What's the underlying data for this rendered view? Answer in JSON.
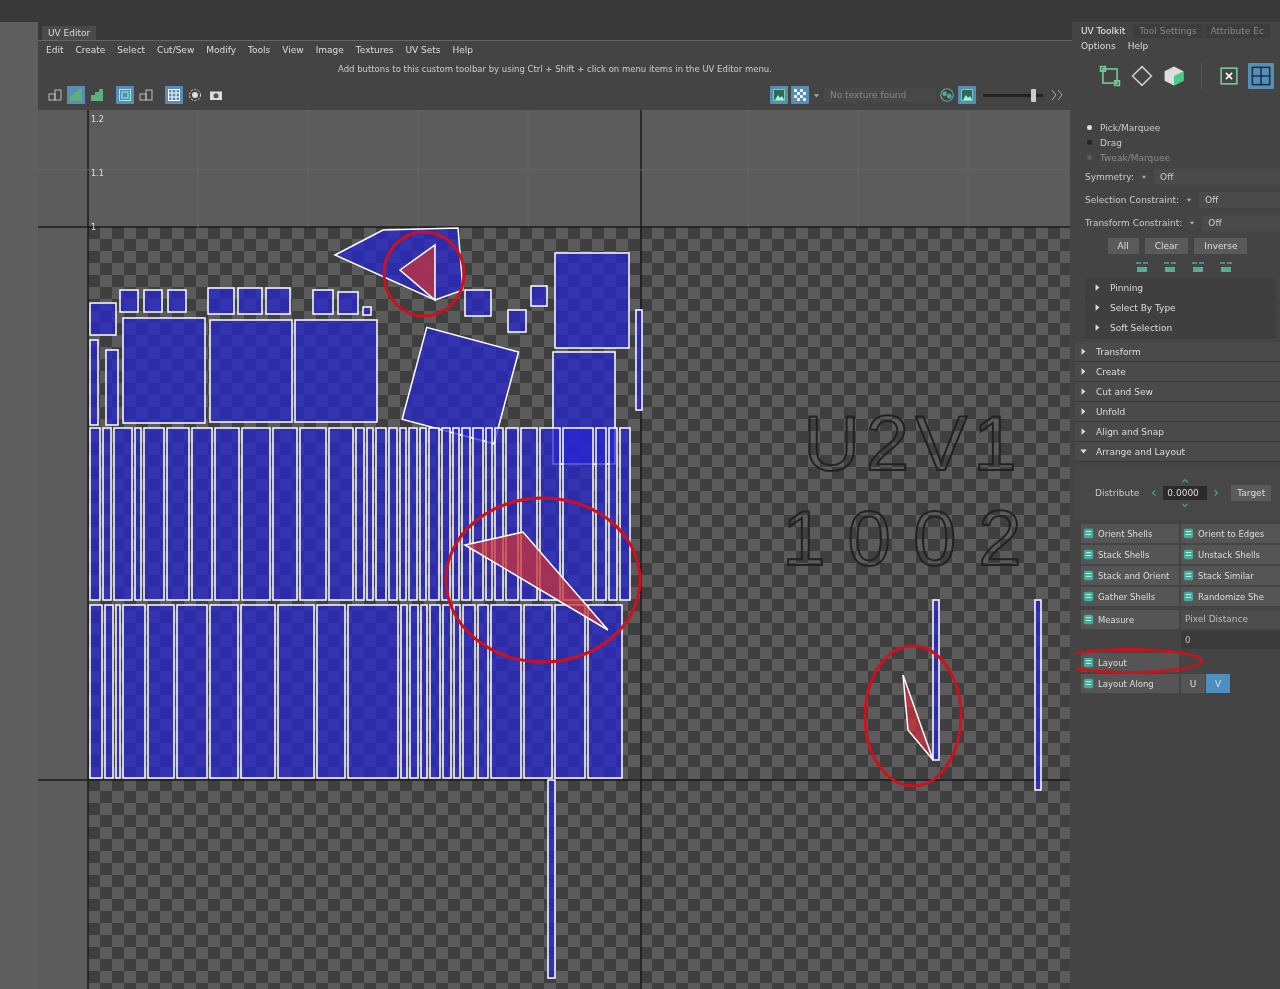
{
  "uv_editor": {
    "title": "UV Editor",
    "menu": [
      "Edit",
      "Create",
      "Select",
      "Cut/Sew",
      "Modify",
      "Tools",
      "View",
      "Image",
      "Textures",
      "UV Sets",
      "Help"
    ],
    "hint": "Add buttons to this custom toolbar by using Ctrl + Shift + click on menu items in the UV Editor menu.",
    "toolbar_left": [
      {
        "kind": "grid",
        "selected": false
      },
      {
        "kind": "shaded",
        "selected": true
      },
      {
        "kind": "shaded",
        "selected": false
      },
      {
        "kind": "frame",
        "selected": true
      },
      {
        "kind": "grid",
        "selected": false
      },
      {
        "kind": "dense-grid",
        "selected": true
      },
      {
        "kind": "dashed-circle",
        "selected": false
      },
      {
        "kind": "camera",
        "selected": false
      }
    ],
    "toolbar_right": [
      {
        "kind": "image",
        "selected": true
      },
      {
        "kind": "checker",
        "selected": true
      }
    ],
    "texture": "No texture found",
    "exposure": {
      "level": 0.85
    }
  },
  "viewport": {
    "axis_labels": [
      "1.2",
      "1.1",
      "1"
    ],
    "tiles": [
      {
        "label": "U2V1",
        "udim": "1002"
      }
    ]
  },
  "toolkit": {
    "tabs": [
      {
        "label": "UV Toolkit",
        "selected": true
      },
      {
        "label": "Tool Settings",
        "selected": false
      },
      {
        "label": "Attribute Ec",
        "selected": false
      }
    ],
    "menu": [
      "Options",
      "Help"
    ],
    "modes": [
      {
        "kind": "vertex",
        "selected": false
      },
      {
        "kind": "edge",
        "selected": false
      },
      {
        "kind": "face",
        "selected": false
      },
      {
        "kind": "uv",
        "selected": false
      },
      {
        "kind": "shell",
        "selected": true
      }
    ],
    "tool_modes": [
      {
        "label": "Pick/Marquee",
        "selected": true,
        "disabled": false
      },
      {
        "label": "Drag",
        "selected": false,
        "disabled": false
      },
      {
        "label": "Tweak/Marquee",
        "selected": false,
        "disabled": true
      }
    ],
    "constraints": [
      {
        "label": "Symmetry:",
        "value": "Off"
      },
      {
        "label": "Selection Constraint:",
        "value": "Off"
      },
      {
        "label": "Transform Constraint:",
        "value": "Off"
      }
    ],
    "buttons": [
      "All",
      "Clear",
      "Inverse"
    ],
    "sections": [
      {
        "label": "Pinning",
        "kind": "sub",
        "expanded": false
      },
      {
        "label": "Select By Type",
        "kind": "sub",
        "expanded": false
      },
      {
        "label": "Soft Selection",
        "kind": "sub",
        "expanded": false
      },
      {
        "label": "Transform",
        "kind": "main",
        "expanded": false
      },
      {
        "label": "Create",
        "kind": "main",
        "expanded": false
      },
      {
        "label": "Cut and Sew",
        "kind": "main",
        "expanded": false
      },
      {
        "label": "Unfold",
        "kind": "main",
        "expanded": false
      },
      {
        "label": "Align and Snap",
        "kind": "main",
        "expanded": false
      },
      {
        "label": "Arrange and Layout",
        "kind": "main",
        "expanded": true
      }
    ],
    "distribute": {
      "label": "Distribute",
      "value": "0.0000",
      "button": "Target"
    },
    "tools": [
      "Orient Shells",
      "Orient to Edges",
      "Stack Shells",
      "Unstack Shells",
      "Stack and Orient",
      "Stack Similar",
      "Gather Shells",
      "Randomize She"
    ],
    "measure": {
      "label": "Measure",
      "mode": "Pixel Distance",
      "value": "0"
    },
    "layout": "Layout",
    "layout_along": {
      "label": "Layout Along",
      "options": [
        {
          "label": "U",
          "selected": false
        },
        {
          "label": "V",
          "selected": true
        }
      ]
    }
  }
}
